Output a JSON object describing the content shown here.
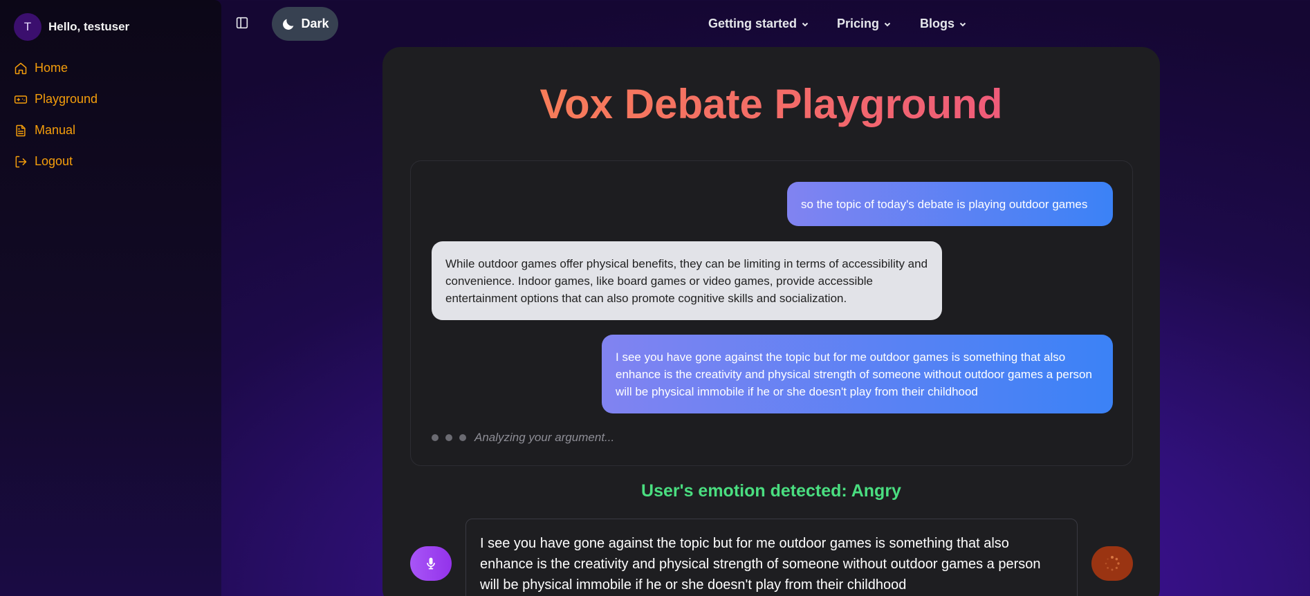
{
  "sidebar": {
    "avatar_initial": "T",
    "greeting": "Hello, testuser",
    "items": [
      {
        "label": "Home",
        "icon": "home-icon"
      },
      {
        "label": "Playground",
        "icon": "gamepad-icon"
      },
      {
        "label": "Manual",
        "icon": "document-icon"
      },
      {
        "label": "Logout",
        "icon": "logout-icon"
      }
    ]
  },
  "header": {
    "theme_label": "Dark",
    "nav": [
      {
        "label": "Getting started"
      },
      {
        "label": "Pricing"
      },
      {
        "label": "Blogs"
      }
    ]
  },
  "main": {
    "title": "Vox Debate Playground",
    "messages": [
      {
        "role": "user",
        "text": "so the topic of today's debate is playing outdoor games"
      },
      {
        "role": "ai",
        "text": "While outdoor games offer physical benefits, they can be limiting in terms of accessibility and convenience. Indoor games, like board games or video games, provide accessible entertainment options that can also promote cognitive skills and socialization."
      },
      {
        "role": "user",
        "text": "I see you have gone against the topic but for me outdoor games is something that also enhance is the creativity and physical strength of someone without outdoor games a person will be physical immobile if he or she doesn't play from their childhood"
      }
    ],
    "typing_text": "Analyzing your argument...",
    "emotion_text": "User's emotion detected: Angry",
    "input_value": "I see you have gone against the topic but for me outdoor games is something that also enhance is the creativity and physical strength of someone without outdoor games a person will be physical immobile if he or she doesn't play from their childhood"
  },
  "colors": {
    "accent": "#f59e0b",
    "emotion": "#4ade80",
    "user_bubble_start": "#8183f1",
    "user_bubble_end": "#3b82f6"
  }
}
